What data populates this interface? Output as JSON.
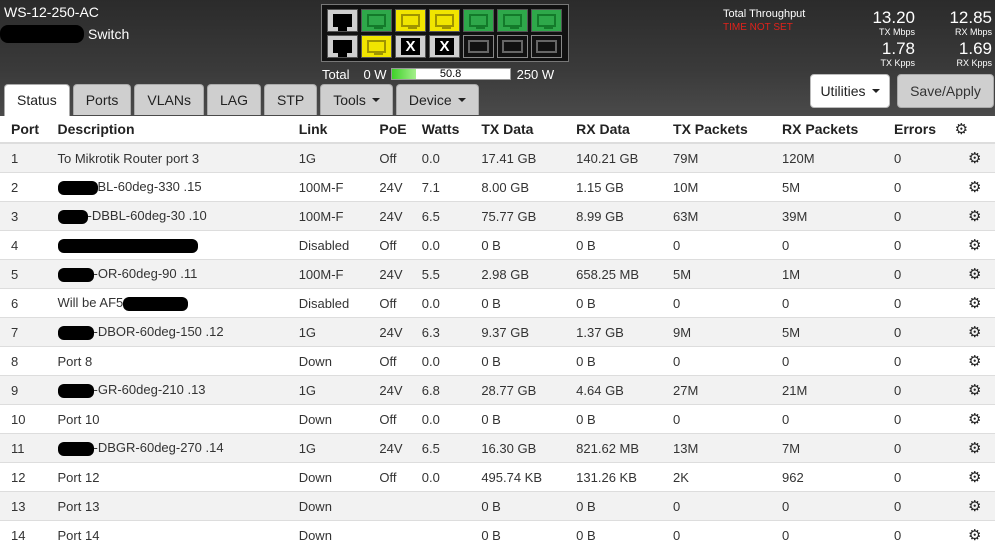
{
  "header": {
    "model": "WS-12-250-AC",
    "device_type": "Switch",
    "power": {
      "label": "Total",
      "min": "0 W",
      "value": "50.8",
      "max": "250 W",
      "fraction": 0.203
    },
    "throughput": {
      "label": "Total Throughput",
      "warning": "TIME NOT SET",
      "tx_mbps": "13.20",
      "tx_mbps_unit": "TX Mbps",
      "rx_mbps": "12.85",
      "rx_mbps_unit": "RX Mbps",
      "tx_kpps": "1.78",
      "tx_kpps_unit": "TX Kpps",
      "rx_kpps": "1.69",
      "rx_kpps_unit": "RX Kpps"
    },
    "port_panel": {
      "top_row": [
        "off",
        "green",
        "yellow",
        "yellow",
        "green",
        "green",
        "green"
      ],
      "bottom_row": [
        "off",
        "yellow",
        "disabled",
        "disabled",
        "sfp",
        "sfp",
        "sfp"
      ]
    }
  },
  "tabs": [
    {
      "label": "Status",
      "active": true
    },
    {
      "label": "Ports"
    },
    {
      "label": "VLANs"
    },
    {
      "label": "LAG"
    },
    {
      "label": "STP"
    },
    {
      "label": "Tools",
      "dropdown": true
    },
    {
      "label": "Device",
      "dropdown": true
    }
  ],
  "actions": {
    "utilities_label": "Utilities",
    "save_label": "Save/Apply"
  },
  "table": {
    "columns": [
      "Port",
      "Description",
      "Link",
      "PoE",
      "Watts",
      "TX Data",
      "RX Data",
      "TX Packets",
      "RX Packets",
      "Errors"
    ],
    "rows": [
      {
        "port": "1",
        "desc": "To Mikrotik Router port 3",
        "link": "1G",
        "poe": "Off",
        "watts": "0.0",
        "tx": "17.41 GB",
        "rx": "140.21 GB",
        "txp": "79M",
        "rxp": "120M",
        "err": "0"
      },
      {
        "port": "2",
        "desc": "BL-60deg-330 .15",
        "link": "100M-F",
        "poe": "24V",
        "watts": "7.1",
        "tx": "8.00 GB",
        "rx": "1.15 GB",
        "txp": "10M",
        "rxp": "5M",
        "err": "0"
      },
      {
        "port": "3",
        "desc": "-DBBL-60deg-30 .10",
        "link": "100M-F",
        "poe": "24V",
        "watts": "6.5",
        "tx": "75.77 GB",
        "rx": "8.99 GB",
        "txp": "63M",
        "rxp": "39M",
        "err": "0"
      },
      {
        "port": "4",
        "desc": "",
        "link": "Disabled",
        "poe": "Off",
        "watts": "0.0",
        "tx": "0 B",
        "rx": "0 B",
        "txp": "0",
        "rxp": "0",
        "err": "0"
      },
      {
        "port": "5",
        "desc": "-OR-60deg-90 .11",
        "link": "100M-F",
        "poe": "24V",
        "watts": "5.5",
        "tx": "2.98 GB",
        "rx": "658.25 MB",
        "txp": "5M",
        "rxp": "1M",
        "err": "0"
      },
      {
        "port": "6",
        "desc": "Will be AF5",
        "link": "Disabled",
        "poe": "Off",
        "watts": "0.0",
        "tx": "0 B",
        "rx": "0 B",
        "txp": "0",
        "rxp": "0",
        "err": "0"
      },
      {
        "port": "7",
        "desc": "-DBOR-60deg-150 .12",
        "link": "1G",
        "poe": "24V",
        "watts": "6.3",
        "tx": "9.37 GB",
        "rx": "1.37 GB",
        "txp": "9M",
        "rxp": "5M",
        "err": "0"
      },
      {
        "port": "8",
        "desc": "Port 8",
        "link": "Down",
        "poe": "Off",
        "watts": "0.0",
        "tx": "0 B",
        "rx": "0 B",
        "txp": "0",
        "rxp": "0",
        "err": "0"
      },
      {
        "port": "9",
        "desc": "-GR-60deg-210 .13",
        "link": "1G",
        "poe": "24V",
        "watts": "6.8",
        "tx": "28.77 GB",
        "rx": "4.64 GB",
        "txp": "27M",
        "rxp": "21M",
        "err": "0"
      },
      {
        "port": "10",
        "desc": "Port 10",
        "link": "Down",
        "poe": "Off",
        "watts": "0.0",
        "tx": "0 B",
        "rx": "0 B",
        "txp": "0",
        "rxp": "0",
        "err": "0"
      },
      {
        "port": "11",
        "desc": "-DBGR-60deg-270 .14",
        "link": "1G",
        "poe": "24V",
        "watts": "6.5",
        "tx": "16.30 GB",
        "rx": "821.62 MB",
        "txp": "13M",
        "rxp": "7M",
        "err": "0"
      },
      {
        "port": "12",
        "desc": "Port 12",
        "link": "Down",
        "poe": "Off",
        "watts": "0.0",
        "tx": "495.74 KB",
        "rx": "131.26 KB",
        "txp": "2K",
        "rxp": "962",
        "err": "0"
      },
      {
        "port": "13",
        "desc": "Port 13",
        "link": "Down",
        "poe": "",
        "watts": "",
        "tx": "0 B",
        "rx": "0 B",
        "txp": "0",
        "rxp": "0",
        "err": "0"
      },
      {
        "port": "14",
        "desc": "Port 14",
        "link": "Down",
        "poe": "",
        "watts": "",
        "tx": "0 B",
        "rx": "0 B",
        "txp": "0",
        "rxp": "0",
        "err": "0"
      }
    ]
  },
  "icons": {
    "settings": "gear-icon",
    "dropdown": "caret-down-icon"
  },
  "colors": {
    "poe_active": "#2d9a1f",
    "warning": "#e0221b",
    "port_link_green": "#2ea84a",
    "port_poe_yellow": "#f1e500"
  }
}
